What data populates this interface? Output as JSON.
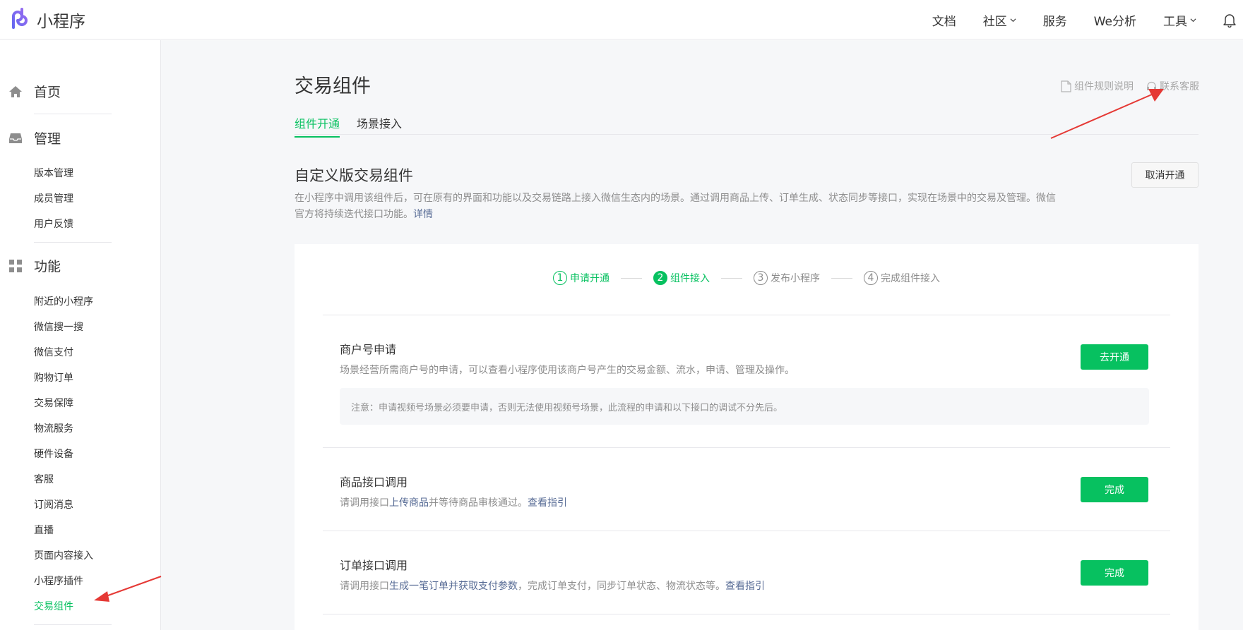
{
  "header": {
    "brand": "小程序",
    "nav": [
      "文档",
      "社区",
      "服务",
      "We分析",
      "工具"
    ]
  },
  "sidebar": {
    "groups": [
      {
        "label": "首页",
        "icon": "home-icon",
        "items": []
      },
      {
        "label": "管理",
        "icon": "inbox-icon",
        "items": [
          "版本管理",
          "成员管理",
          "用户反馈"
        ]
      },
      {
        "label": "功能",
        "icon": "grid-icon",
        "items": [
          "附近的小程序",
          "微信搜一搜",
          "微信支付",
          "购物订单",
          "交易保障",
          "物流服务",
          "硬件设备",
          "客服",
          "订阅消息",
          "直播",
          "页面内容接入",
          "小程序插件",
          "交易组件"
        ]
      }
    ],
    "active_item": "交易组件"
  },
  "main": {
    "title": "交易组件",
    "links": {
      "rules": "组件规则说明",
      "support": "联系客服"
    },
    "tabs": [
      "组件开通",
      "场景接入"
    ],
    "active_tab": "组件开通",
    "section": {
      "title": "自定义版交易组件",
      "cancel_label": "取消开通",
      "desc": "在小程序中调用该组件后，可在原有的界面和功能以及交易链路上接入微信生态内的场景。通过调用商品上传、订单生成、状态同步等接口，实现在场景中的交易及管理。微信官方将持续迭代接口功能。",
      "desc_link": "详情"
    },
    "steps": [
      {
        "num": "1",
        "label": "申请开通",
        "state": "done"
      },
      {
        "num": "2",
        "label": "组件接入",
        "state": "current"
      },
      {
        "num": "3",
        "label": "发布小程序",
        "state": "pending"
      },
      {
        "num": "4",
        "label": "完成组件接入",
        "state": "pending"
      }
    ],
    "items": [
      {
        "title": "商户号申请",
        "desc": "场景经营所需商户号的申请，可以查看小程序使用该商户号产生的交易金额、流水，申请、管理及操作。",
        "notice": "注意：申请视频号场景必须要申请，否则无法使用视频号场景，此流程的申请和以下接口的调试不分先后。",
        "button": "去开通"
      },
      {
        "title": "商品接口调用",
        "desc_pre": "请调用接口",
        "desc_link1": "上传商品",
        "desc_mid": "并等待商品审核通过。",
        "desc_link2": "查看指引",
        "button": "完成"
      },
      {
        "title": "订单接口调用",
        "desc_pre": "请调用接口",
        "desc_link1": "生成一笔订单并获取支付参数",
        "desc_mid": "，完成订单支付，同步订单状态、物流状态等。",
        "desc_link2": "查看指引",
        "button": "完成"
      }
    ]
  },
  "colors": {
    "accent": "#07c160",
    "link": "#576b95",
    "annotation": "#e53935"
  }
}
